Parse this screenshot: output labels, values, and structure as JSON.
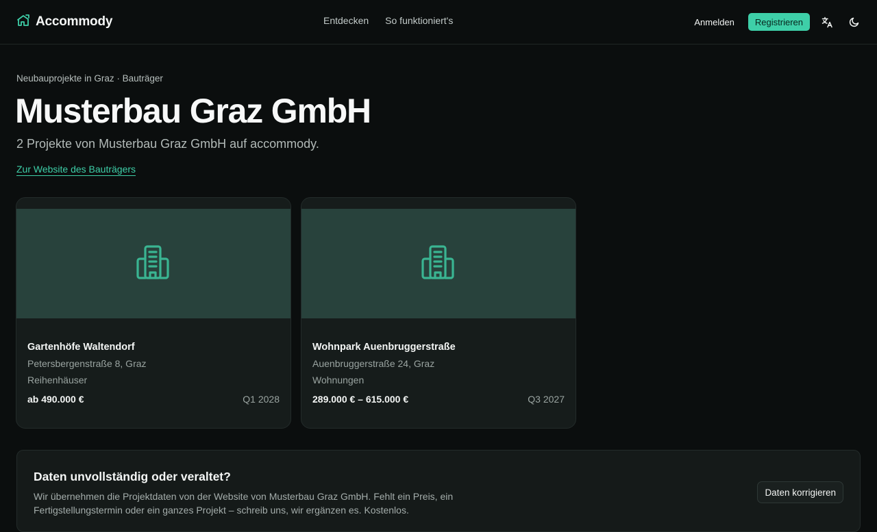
{
  "nav": {
    "brand": "Accommody",
    "links": [
      "Entdecken",
      "So funktioniert's"
    ],
    "login": "Anmelden",
    "register": "Registrieren",
    "icons": [
      "translate-icon",
      "moon-icon"
    ]
  },
  "header": {
    "breadcrumb": "Neubauprojekte in Graz · Bauträger",
    "title": "Musterbau Graz GmbH",
    "subtitle": "2 Projekte von Musterbau Graz GmbH auf accommody.",
    "website_link": "Zur Website des Bauträgers"
  },
  "projects": [
    {
      "title": "Gartenhöfe Waltendorf",
      "address": "Petersbergenstraße 8, Graz",
      "type": "Reihenhäuser",
      "price": "ab 490.000 €",
      "completion": "Q1 2028",
      "icon": "building-icon"
    },
    {
      "title": "Wohnpark Auenbruggerstraße",
      "address": "Auenbruggerstraße 24, Graz",
      "type": "Wohnungen",
      "price": "289.000 € – 615.000 €",
      "completion": "Q3 2027",
      "icon": "building-icon"
    }
  ],
  "notice": {
    "title": "Daten unvollständig oder veraltet?",
    "text": "Wir übernehmen die Projektdaten von der Website von Musterbau Graz GmbH. Fehlt ein Preis, ein Fertigstellungstermin oder ein ganzes Projekt – schreib uns, wir ergänzen es. Kostenlos.",
    "button": "Daten korrigieren"
  },
  "colors": {
    "accent": "#3ecfa8",
    "background": "#0b0e0e",
    "card": "#161c1b",
    "image_placeholder": "#28423c"
  }
}
